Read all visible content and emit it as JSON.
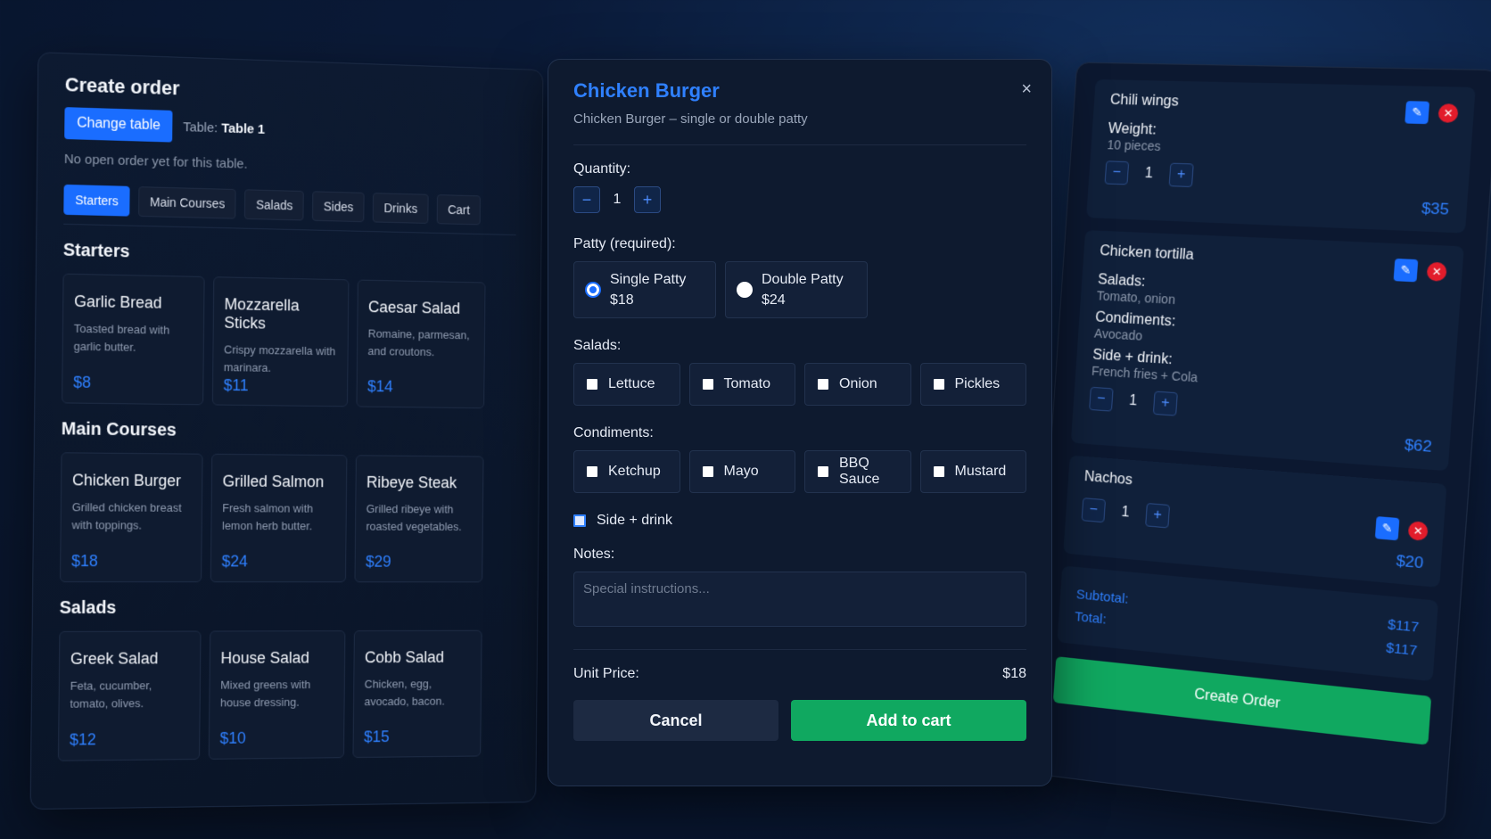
{
  "order": {
    "title": "Create order",
    "change_table_label": "Change table",
    "table_prefix": "Table:",
    "table_name": "Table 1",
    "no_order_text": "No open order yet for this table."
  },
  "tabs": [
    {
      "label": "Starters"
    },
    {
      "label": "Main Courses"
    },
    {
      "label": "Salads"
    },
    {
      "label": "Sides"
    },
    {
      "label": "Drinks"
    },
    {
      "label": "Cart"
    }
  ],
  "sections": [
    {
      "title": "Starters",
      "items": [
        {
          "name": "Garlic Bread",
          "desc": "Toasted bread with garlic butter.",
          "price": "$8"
        },
        {
          "name": "Mozzarella Sticks",
          "desc": "Crispy mozzarella with marinara.",
          "price": "$11"
        },
        {
          "name": "Caesar Salad",
          "desc": "Romaine, parmesan, and croutons.",
          "price": "$14"
        }
      ]
    },
    {
      "title": "Main Courses",
      "items": [
        {
          "name": "Chicken Burger",
          "desc": "Grilled chicken breast with toppings.",
          "price": "$18"
        },
        {
          "name": "Grilled Salmon",
          "desc": "Fresh salmon with lemon herb butter.",
          "price": "$24"
        },
        {
          "name": "Ribeye Steak",
          "desc": "Grilled ribeye with roasted vegetables.",
          "price": "$29"
        }
      ]
    },
    {
      "title": "Salads",
      "items": [
        {
          "name": "Greek Salad",
          "desc": "Feta, cucumber, tomato, olives.",
          "price": "$12"
        },
        {
          "name": "House Salad",
          "desc": "Mixed greens with house dressing.",
          "price": "$10"
        },
        {
          "name": "Cobb Salad",
          "desc": "Chicken, egg, avocado, bacon.",
          "price": "$15"
        }
      ]
    }
  ],
  "modal": {
    "title": "Chicken Burger",
    "subtitle": "Chicken Burger – single or double patty",
    "close_glyph": "×",
    "quantity_label": "Quantity:",
    "quantity": "1",
    "minus": "−",
    "plus": "+",
    "patty_label": "Patty (required):",
    "patty_options": [
      {
        "name": "Single Patty",
        "price": "$18",
        "selected": true
      },
      {
        "name": "Double Patty",
        "price": "$24",
        "selected": false
      }
    ],
    "salads_label": "Salads:",
    "salads": [
      "Lettuce",
      "Tomato",
      "Onion",
      "Pickles"
    ],
    "condiments_label": "Condiments:",
    "condiments": [
      "Ketchup",
      "Mayo",
      "BBQ Sauce",
      "Mustard"
    ],
    "side_drink_label": "Side + drink",
    "notes_label": "Notes:",
    "notes_placeholder": "Special instructions...",
    "unit_price_label": "Unit Price:",
    "unit_price": "$18",
    "cancel_label": "Cancel",
    "add_label": "Add to cart"
  },
  "cart": {
    "items": [
      {
        "name": "Chili wings",
        "details": [
          {
            "label": "Weight:",
            "value": "10 pieces"
          }
        ],
        "qty": "1",
        "price": "$35"
      },
      {
        "name": "Chicken tortilla",
        "details": [
          {
            "label": "Salads:",
            "value": "Tomato, onion"
          },
          {
            "label": "Condiments:",
            "value": "Avocado"
          },
          {
            "label": "Side + drink:",
            "value": "French fries + Cola"
          }
        ],
        "qty": "1",
        "price": "$62"
      },
      {
        "name": "Nachos",
        "details": [],
        "qty": "1",
        "price": "$20"
      }
    ],
    "subtotal_label": "Subtotal:",
    "subtotal": "$117",
    "total_label": "Total:",
    "total": "$117",
    "create_label": "Create Order"
  },
  "colors": {
    "accent": "#2f80ff",
    "primary_button": "#1a6dff",
    "success": "#10a860",
    "danger": "#e21c2b"
  }
}
